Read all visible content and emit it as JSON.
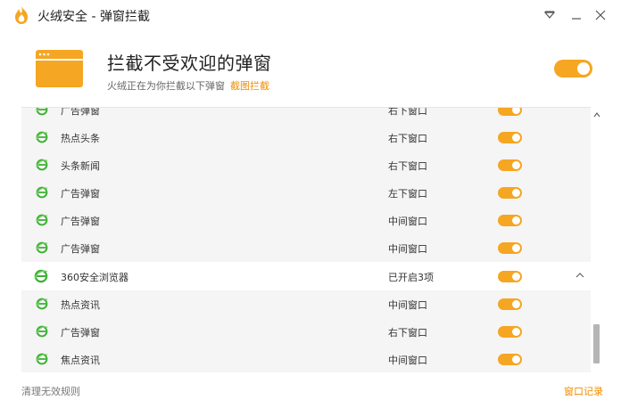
{
  "window": {
    "title": "火绒安全 - 弹窗拦截"
  },
  "header": {
    "title": "拦截不受欢迎的弹窗",
    "subtitle": "火绒正在为你拦截以下弹窗",
    "link": "截图拦截",
    "enabled": true
  },
  "colors": {
    "accent": "#f5a623",
    "link": "#f08c00",
    "ie_green": "#3cb034"
  },
  "list": {
    "rows_top": [
      {
        "name": "广告弹窗",
        "position": "右下窗口",
        "enabled": true
      },
      {
        "name": "热点头条",
        "position": "右下窗口",
        "enabled": true
      },
      {
        "name": "头条新闻",
        "position": "右下窗口",
        "enabled": true
      },
      {
        "name": "广告弹窗",
        "position": "左下窗口",
        "enabled": true
      },
      {
        "name": "广告弹窗",
        "position": "中间窗口",
        "enabled": true
      },
      {
        "name": "广告弹窗",
        "position": "中间窗口",
        "enabled": true
      }
    ],
    "group": {
      "name": "360安全浏览器",
      "status": "已开启3项",
      "enabled": true,
      "icon": "chevron-up-icon"
    },
    "rows_group": [
      {
        "name": "热点资讯",
        "position": "中间窗口",
        "enabled": true
      },
      {
        "name": "广告弹窗",
        "position": "右下窗口",
        "enabled": true
      },
      {
        "name": "焦点资讯",
        "position": "中间窗口",
        "enabled": true
      }
    ]
  },
  "footer": {
    "clear_invalid": "清理无效规则",
    "history": "窗口记录"
  }
}
